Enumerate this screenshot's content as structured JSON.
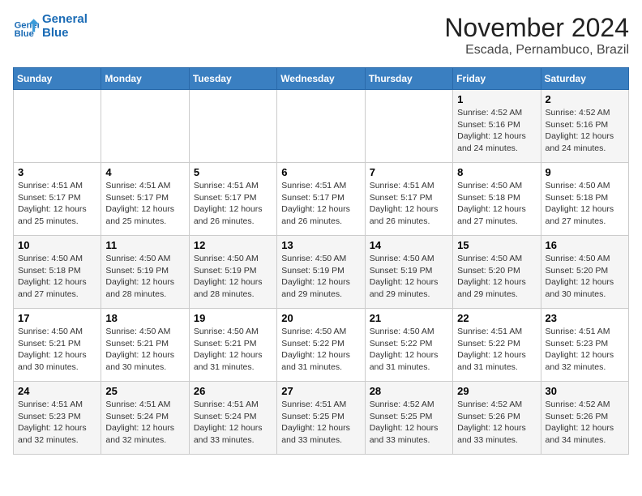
{
  "header": {
    "logo_line1": "General",
    "logo_line2": "Blue",
    "title": "November 2024",
    "subtitle": "Escada, Pernambuco, Brazil"
  },
  "weekdays": [
    "Sunday",
    "Monday",
    "Tuesday",
    "Wednesday",
    "Thursday",
    "Friday",
    "Saturday"
  ],
  "weeks": [
    [
      {
        "day": "",
        "info": ""
      },
      {
        "day": "",
        "info": ""
      },
      {
        "day": "",
        "info": ""
      },
      {
        "day": "",
        "info": ""
      },
      {
        "day": "",
        "info": ""
      },
      {
        "day": "1",
        "info": "Sunrise: 4:52 AM\nSunset: 5:16 PM\nDaylight: 12 hours and 24 minutes."
      },
      {
        "day": "2",
        "info": "Sunrise: 4:52 AM\nSunset: 5:16 PM\nDaylight: 12 hours and 24 minutes."
      }
    ],
    [
      {
        "day": "3",
        "info": "Sunrise: 4:51 AM\nSunset: 5:17 PM\nDaylight: 12 hours and 25 minutes."
      },
      {
        "day": "4",
        "info": "Sunrise: 4:51 AM\nSunset: 5:17 PM\nDaylight: 12 hours and 25 minutes."
      },
      {
        "day": "5",
        "info": "Sunrise: 4:51 AM\nSunset: 5:17 PM\nDaylight: 12 hours and 26 minutes."
      },
      {
        "day": "6",
        "info": "Sunrise: 4:51 AM\nSunset: 5:17 PM\nDaylight: 12 hours and 26 minutes."
      },
      {
        "day": "7",
        "info": "Sunrise: 4:51 AM\nSunset: 5:17 PM\nDaylight: 12 hours and 26 minutes."
      },
      {
        "day": "8",
        "info": "Sunrise: 4:50 AM\nSunset: 5:18 PM\nDaylight: 12 hours and 27 minutes."
      },
      {
        "day": "9",
        "info": "Sunrise: 4:50 AM\nSunset: 5:18 PM\nDaylight: 12 hours and 27 minutes."
      }
    ],
    [
      {
        "day": "10",
        "info": "Sunrise: 4:50 AM\nSunset: 5:18 PM\nDaylight: 12 hours and 27 minutes."
      },
      {
        "day": "11",
        "info": "Sunrise: 4:50 AM\nSunset: 5:19 PM\nDaylight: 12 hours and 28 minutes."
      },
      {
        "day": "12",
        "info": "Sunrise: 4:50 AM\nSunset: 5:19 PM\nDaylight: 12 hours and 28 minutes."
      },
      {
        "day": "13",
        "info": "Sunrise: 4:50 AM\nSunset: 5:19 PM\nDaylight: 12 hours and 29 minutes."
      },
      {
        "day": "14",
        "info": "Sunrise: 4:50 AM\nSunset: 5:19 PM\nDaylight: 12 hours and 29 minutes."
      },
      {
        "day": "15",
        "info": "Sunrise: 4:50 AM\nSunset: 5:20 PM\nDaylight: 12 hours and 29 minutes."
      },
      {
        "day": "16",
        "info": "Sunrise: 4:50 AM\nSunset: 5:20 PM\nDaylight: 12 hours and 30 minutes."
      }
    ],
    [
      {
        "day": "17",
        "info": "Sunrise: 4:50 AM\nSunset: 5:21 PM\nDaylight: 12 hours and 30 minutes."
      },
      {
        "day": "18",
        "info": "Sunrise: 4:50 AM\nSunset: 5:21 PM\nDaylight: 12 hours and 30 minutes."
      },
      {
        "day": "19",
        "info": "Sunrise: 4:50 AM\nSunset: 5:21 PM\nDaylight: 12 hours and 31 minutes."
      },
      {
        "day": "20",
        "info": "Sunrise: 4:50 AM\nSunset: 5:22 PM\nDaylight: 12 hours and 31 minutes."
      },
      {
        "day": "21",
        "info": "Sunrise: 4:50 AM\nSunset: 5:22 PM\nDaylight: 12 hours and 31 minutes."
      },
      {
        "day": "22",
        "info": "Sunrise: 4:51 AM\nSunset: 5:22 PM\nDaylight: 12 hours and 31 minutes."
      },
      {
        "day": "23",
        "info": "Sunrise: 4:51 AM\nSunset: 5:23 PM\nDaylight: 12 hours and 32 minutes."
      }
    ],
    [
      {
        "day": "24",
        "info": "Sunrise: 4:51 AM\nSunset: 5:23 PM\nDaylight: 12 hours and 32 minutes."
      },
      {
        "day": "25",
        "info": "Sunrise: 4:51 AM\nSunset: 5:24 PM\nDaylight: 12 hours and 32 minutes."
      },
      {
        "day": "26",
        "info": "Sunrise: 4:51 AM\nSunset: 5:24 PM\nDaylight: 12 hours and 33 minutes."
      },
      {
        "day": "27",
        "info": "Sunrise: 4:51 AM\nSunset: 5:25 PM\nDaylight: 12 hours and 33 minutes."
      },
      {
        "day": "28",
        "info": "Sunrise: 4:52 AM\nSunset: 5:25 PM\nDaylight: 12 hours and 33 minutes."
      },
      {
        "day": "29",
        "info": "Sunrise: 4:52 AM\nSunset: 5:26 PM\nDaylight: 12 hours and 33 minutes."
      },
      {
        "day": "30",
        "info": "Sunrise: 4:52 AM\nSunset: 5:26 PM\nDaylight: 12 hours and 34 minutes."
      }
    ]
  ]
}
